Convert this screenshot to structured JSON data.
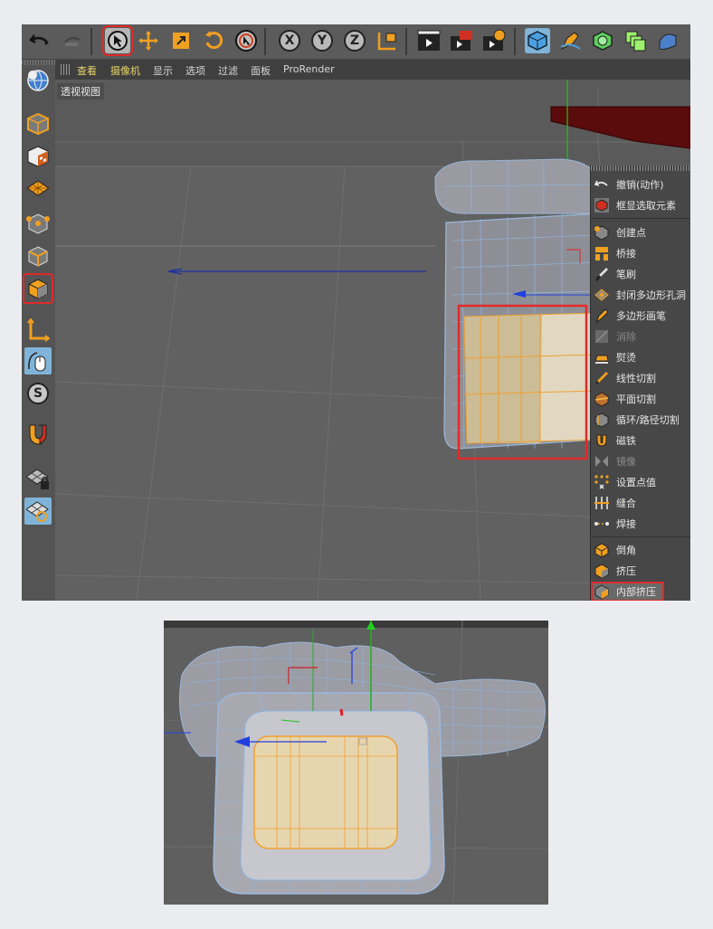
{
  "viewport": {
    "menus": [
      "查看",
      "摄像机",
      "显示",
      "选项",
      "过滤",
      "面板",
      "ProRender"
    ],
    "active_menu": "摄像机",
    "view_label": "透视视图"
  },
  "toolbar": {
    "x_label": "X",
    "y_label": "Y",
    "z_label": "Z"
  },
  "leftbar": {
    "s_label": "S"
  },
  "context_menu": {
    "items": [
      {
        "label": "撤销(动作)",
        "enabled": true
      },
      {
        "label": "框显选取元素",
        "enabled": true
      },
      {
        "label": "创建点",
        "enabled": true
      },
      {
        "label": "桥接",
        "enabled": true
      },
      {
        "label": "笔刷",
        "enabled": true
      },
      {
        "label": "封闭多边形孔洞",
        "enabled": true
      },
      {
        "label": "多边形画笔",
        "enabled": true
      },
      {
        "label": "消除",
        "enabled": false
      },
      {
        "label": "熨烫",
        "enabled": true
      },
      {
        "label": "线性切割",
        "enabled": true
      },
      {
        "label": "平面切割",
        "enabled": true
      },
      {
        "label": "循环/路径切割",
        "enabled": true
      },
      {
        "label": "磁铁",
        "enabled": true
      },
      {
        "label": "镜像",
        "enabled": false
      },
      {
        "label": "设置点值",
        "enabled": true
      },
      {
        "label": "缝合",
        "enabled": true
      },
      {
        "label": "焊接",
        "enabled": true
      },
      {
        "label": "倒角",
        "enabled": true
      },
      {
        "label": "挤压",
        "enabled": true
      },
      {
        "label": "内部挤压",
        "enabled": true
      }
    ],
    "highlighted": "内部挤压"
  },
  "colors": {
    "highlight_red": "#e02a2a",
    "selection_orange": "#f0a030",
    "wire_blue": "#8ab8e8",
    "face_fill": "#e6d6b0"
  }
}
